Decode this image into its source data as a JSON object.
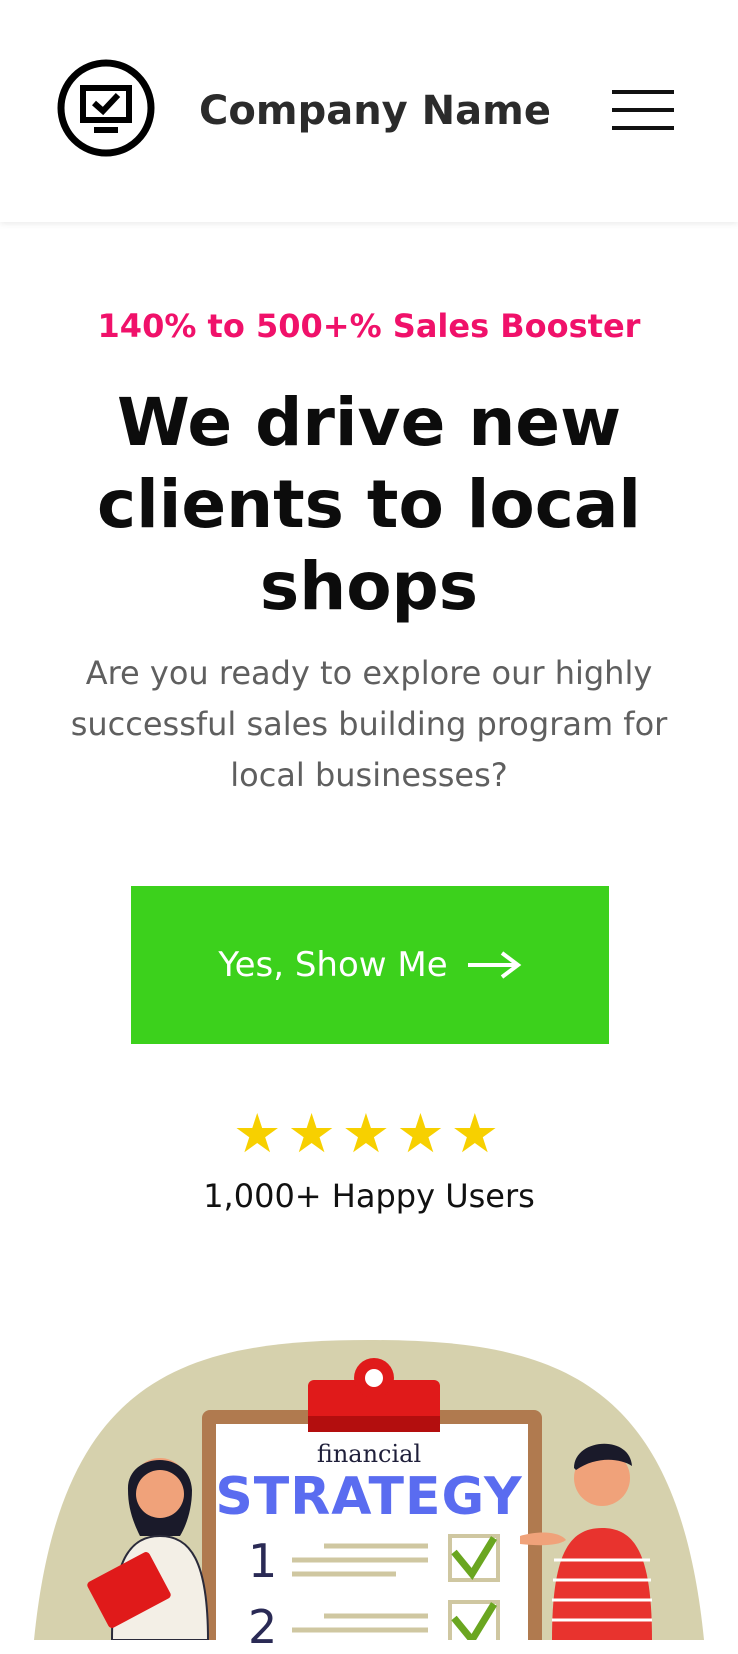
{
  "header": {
    "company_name": "Company Name",
    "logo_icon": "monitor-check-icon",
    "menu_icon": "hamburger-menu-icon"
  },
  "hero": {
    "eyebrow": "140% to 500+% Sales Booster",
    "headline": "We drive new clients to local shops",
    "subtext": "Are you ready to explore our highly successful sales building program for local businesses?",
    "cta_label": "Yes, Show Me",
    "cta_icon": "arrow-right-icon"
  },
  "rating": {
    "stars": "★★★★★",
    "star_count": 5,
    "caption": "1,000+ Happy Users"
  },
  "illustration": {
    "title_small": "financial",
    "title_large": "STRATEGY",
    "items": [
      "1",
      "2"
    ]
  },
  "colors": {
    "accent_pink": "#f0116a",
    "cta_green": "#3cd11c",
    "star_yellow": "#f7d000",
    "subtext_gray": "#5f5f5f",
    "strategy_blue": "#5a6cf0",
    "clipboard_red": "#e01a1a"
  }
}
